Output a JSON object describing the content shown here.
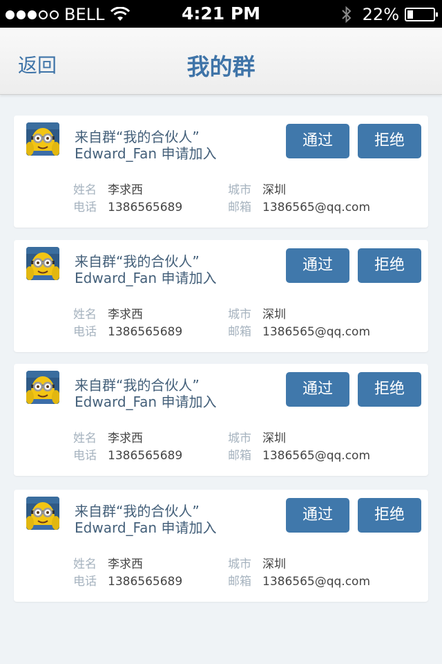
{
  "status_bar": {
    "carrier": "BELL",
    "signal_bars_filled": 3,
    "signal_bars_total": 5,
    "time": "4:21 PM",
    "battery_percent": "22%",
    "battery_level": 0.22
  },
  "navbar": {
    "back_label": "返回",
    "title": "我的群"
  },
  "colors": {
    "accent": "#4078ab",
    "title_blue": "#3f74a8",
    "background": "#eff3f6"
  },
  "requests": [
    {
      "group_text": "来自群“我的合伙人”",
      "request_text": "Edward_Fan 申请加入",
      "approve_label": "通过",
      "reject_label": "拒绝",
      "name_key": "姓名",
      "name_value": "李求西",
      "phone_key": "电话",
      "phone_value": "1386565689",
      "city_key": "城市",
      "city_value": "深圳",
      "email_key": "邮箱",
      "email_value": "1386565@qq.com"
    },
    {
      "group_text": "来自群“我的合伙人”",
      "request_text": "Edward_Fan 申请加入",
      "approve_label": "通过",
      "reject_label": "拒绝",
      "name_key": "姓名",
      "name_value": "李求西",
      "phone_key": "电话",
      "phone_value": "1386565689",
      "city_key": "城市",
      "city_value": "深圳",
      "email_key": "邮箱",
      "email_value": "1386565@qq.com"
    },
    {
      "group_text": "来自群“我的合伙人”",
      "request_text": "Edward_Fan 申请加入",
      "approve_label": "通过",
      "reject_label": "拒绝",
      "name_key": "姓名",
      "name_value": "李求西",
      "phone_key": "电话",
      "phone_value": "1386565689",
      "city_key": "城市",
      "city_value": "深圳",
      "email_key": "邮箱",
      "email_value": "1386565@qq.com"
    },
    {
      "group_text": "来自群“我的合伙人”",
      "request_text": "Edward_Fan 申请加入",
      "approve_label": "通过",
      "reject_label": "拒绝",
      "name_key": "姓名",
      "name_value": "李求西",
      "phone_key": "电话",
      "phone_value": "1386565689",
      "city_key": "城市",
      "city_value": "深圳",
      "email_key": "邮箱",
      "email_value": "1386565@qq.com"
    }
  ]
}
